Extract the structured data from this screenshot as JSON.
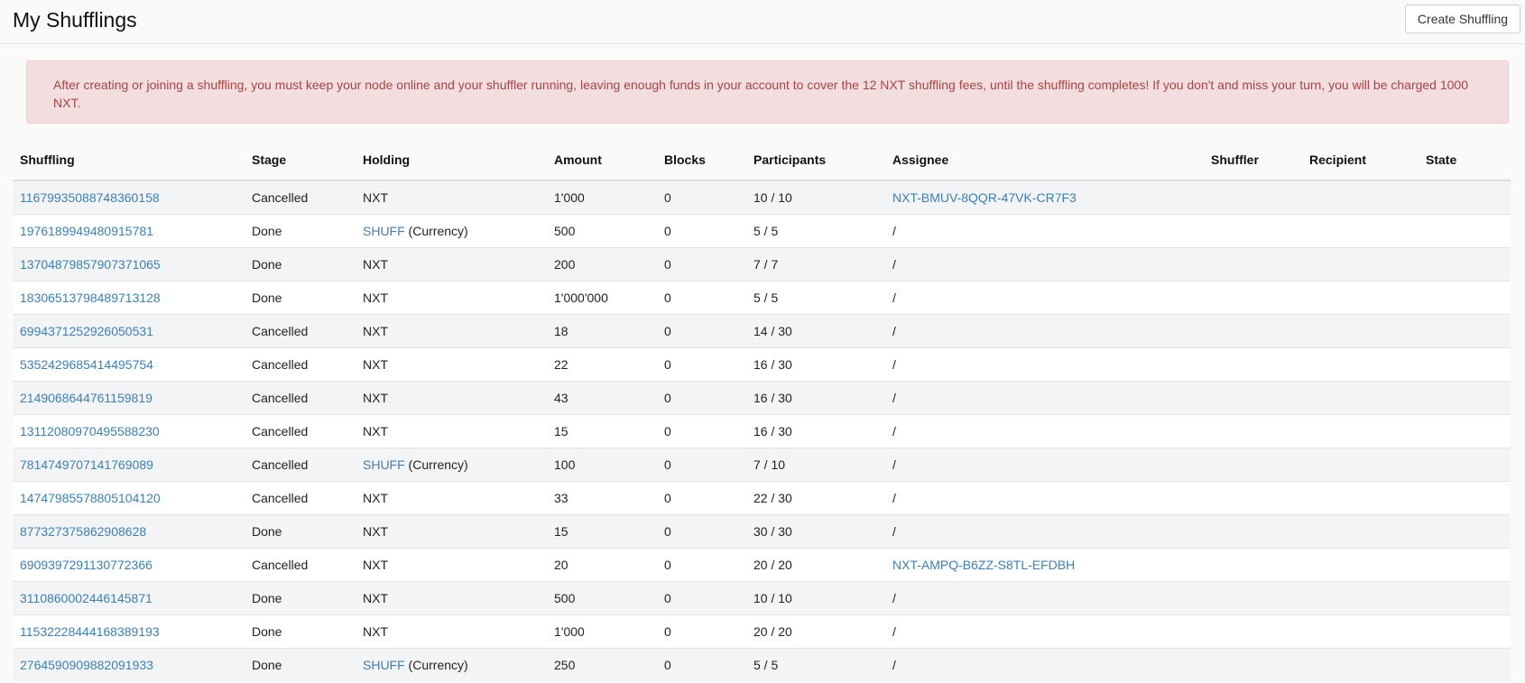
{
  "header": {
    "title": "My Shufflings",
    "create_button": "Create Shuffling"
  },
  "alert": {
    "text": "After creating or joining a shuffling, you must keep your node online and your shuffler running, leaving enough funds in your account to cover the 12 NXT shuffling fees, until the shuffling completes! If you don't and miss your turn, you will be charged 1000 NXT."
  },
  "colors": {
    "link": "#3a80b8",
    "alert_bg": "#f2dede",
    "alert_text": "#a94442"
  },
  "table": {
    "headers": {
      "shuffling": "Shuffling",
      "stage": "Stage",
      "holding": "Holding",
      "amount": "Amount",
      "blocks": "Blocks",
      "participants": "Participants",
      "assignee": "Assignee",
      "shuffler": "Shuffler",
      "recipient": "Recipient",
      "state": "State"
    },
    "rows": [
      {
        "id": "11679935088748360158",
        "stage": "Cancelled",
        "holding": "NXT",
        "currency_suffix": "",
        "amount": "1'000",
        "blocks": "0",
        "participants": "10 / 10",
        "assignee": "NXT-BMUV-8QQR-47VK-CR7F3",
        "assignee_link": true
      },
      {
        "id": "1976189949480915781",
        "stage": "Done",
        "holding": "SHUFF",
        "currency_suffix": " (Currency)",
        "amount": "500",
        "blocks": "0",
        "participants": "5 / 5",
        "assignee": "/",
        "assignee_link": false
      },
      {
        "id": "13704879857907371065",
        "stage": "Done",
        "holding": "NXT",
        "currency_suffix": "",
        "amount": "200",
        "blocks": "0",
        "participants": "7 / 7",
        "assignee": "/",
        "assignee_link": false
      },
      {
        "id": "18306513798489713128",
        "stage": "Done",
        "holding": "NXT",
        "currency_suffix": "",
        "amount": "1'000'000",
        "blocks": "0",
        "participants": "5 / 5",
        "assignee": "/",
        "assignee_link": false
      },
      {
        "id": "6994371252926050531",
        "stage": "Cancelled",
        "holding": "NXT",
        "currency_suffix": "",
        "amount": "18",
        "blocks": "0",
        "participants": "14 / 30",
        "assignee": "/",
        "assignee_link": false
      },
      {
        "id": "5352429685414495754",
        "stage": "Cancelled",
        "holding": "NXT",
        "currency_suffix": "",
        "amount": "22",
        "blocks": "0",
        "participants": "16 / 30",
        "assignee": "/",
        "assignee_link": false
      },
      {
        "id": "2149068644761159819",
        "stage": "Cancelled",
        "holding": "NXT",
        "currency_suffix": "",
        "amount": "43",
        "blocks": "0",
        "participants": "16 / 30",
        "assignee": "/",
        "assignee_link": false
      },
      {
        "id": "13112080970495588230",
        "stage": "Cancelled",
        "holding": "NXT",
        "currency_suffix": "",
        "amount": "15",
        "blocks": "0",
        "participants": "16 / 30",
        "assignee": "/",
        "assignee_link": false
      },
      {
        "id": "7814749707141769089",
        "stage": "Cancelled",
        "holding": "SHUFF",
        "currency_suffix": " (Currency)",
        "amount": "100",
        "blocks": "0",
        "participants": "7 / 10",
        "assignee": "/",
        "assignee_link": false
      },
      {
        "id": "14747985578805104120",
        "stage": "Cancelled",
        "holding": "NXT",
        "currency_suffix": "",
        "amount": "33",
        "blocks": "0",
        "participants": "22 / 30",
        "assignee": "/",
        "assignee_link": false
      },
      {
        "id": "877327375862908628",
        "stage": "Done",
        "holding": "NXT",
        "currency_suffix": "",
        "amount": "15",
        "blocks": "0",
        "participants": "30 / 30",
        "assignee": "/",
        "assignee_link": false
      },
      {
        "id": "6909397291130772366",
        "stage": "Cancelled",
        "holding": "NXT",
        "currency_suffix": "",
        "amount": "20",
        "blocks": "0",
        "participants": "20 / 20",
        "assignee": "NXT-AMPQ-B6ZZ-S8TL-EFDBH",
        "assignee_link": true
      },
      {
        "id": "3110860002446145871",
        "stage": "Done",
        "holding": "NXT",
        "currency_suffix": "",
        "amount": "500",
        "blocks": "0",
        "participants": "10 / 10",
        "assignee": "/",
        "assignee_link": false
      },
      {
        "id": "11532228444168389193",
        "stage": "Done",
        "holding": "NXT",
        "currency_suffix": "",
        "amount": "1'000",
        "blocks": "0",
        "participants": "20 / 20",
        "assignee": "/",
        "assignee_link": false
      },
      {
        "id": "2764590909882091933",
        "stage": "Done",
        "holding": "SHUFF",
        "currency_suffix": " (Currency)",
        "amount": "250",
        "blocks": "0",
        "participants": "5 / 5",
        "assignee": "/",
        "assignee_link": false
      }
    ]
  }
}
